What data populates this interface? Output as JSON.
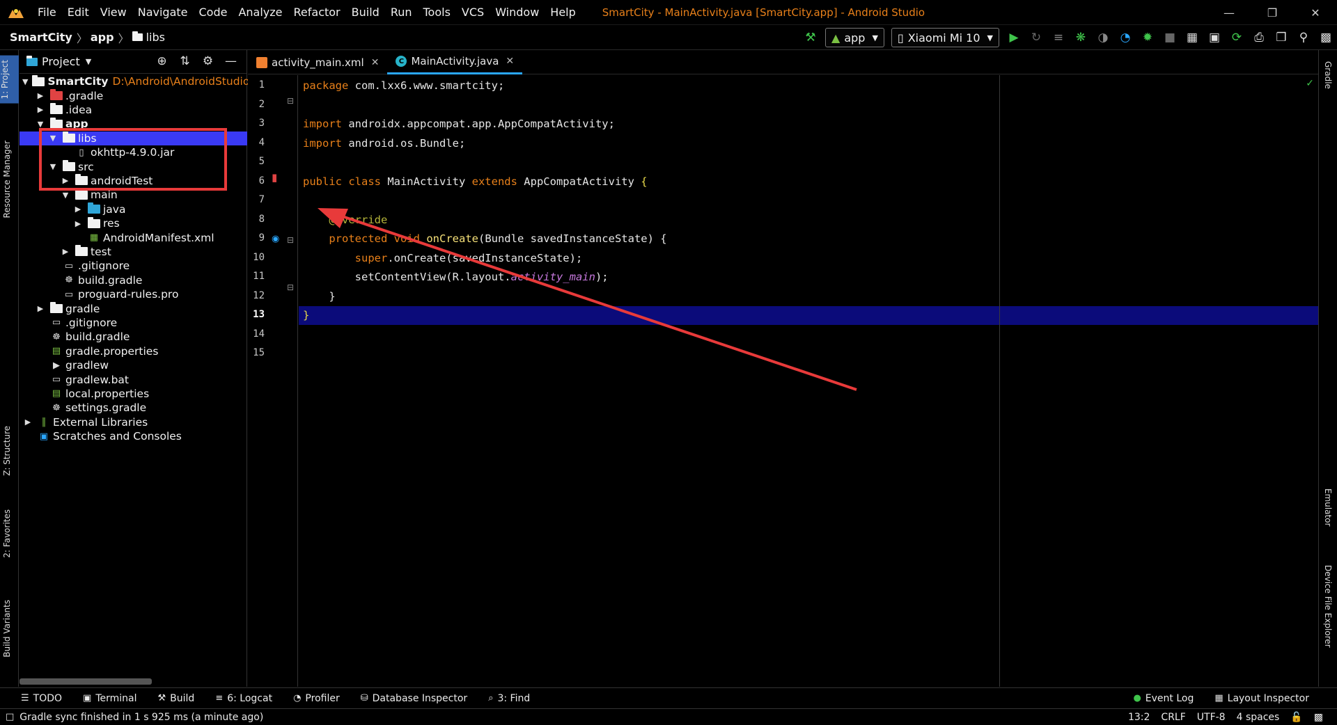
{
  "menu": [
    "File",
    "Edit",
    "View",
    "Navigate",
    "Code",
    "Analyze",
    "Refactor",
    "Build",
    "Run",
    "Tools",
    "VCS",
    "Window",
    "Help"
  ],
  "window_title": "SmartCity - MainActivity.java [SmartCity.app] - Android Studio",
  "breadcrumb": {
    "project": "SmartCity",
    "module": "app",
    "folder": "libs"
  },
  "toolbar": {
    "run_config": "app",
    "device": "Xiaomi Mi 10"
  },
  "left_strip": {
    "project": "1: Project",
    "resource_manager": "Resource Manager",
    "structure": "Z: Structure",
    "favorites": "2: Favorites",
    "build_variants": "Build Variants"
  },
  "right_strip": {
    "gradle": "Gradle",
    "emulator": "Emulator",
    "device_file_explorer": "Device File Explorer"
  },
  "project_panel": {
    "title": "Project",
    "tree": [
      {
        "label": "SmartCity",
        "hint": "D:\\Android\\AndroidStudio",
        "depth": 0,
        "toggle": "▼",
        "icon": "folder",
        "bold": true
      },
      {
        "label": ".gradle",
        "depth": 1,
        "toggle": "▶",
        "icon": "folder-red"
      },
      {
        "label": ".idea",
        "depth": 1,
        "toggle": "▶",
        "icon": "folder"
      },
      {
        "label": "app",
        "depth": 1,
        "toggle": "▼",
        "icon": "folder",
        "bold": true
      },
      {
        "label": "libs",
        "depth": 2,
        "toggle": "▼",
        "icon": "folder",
        "selected": true
      },
      {
        "label": "okhttp-4.9.0.jar",
        "depth": 3,
        "toggle": "",
        "icon": "jar"
      },
      {
        "label": "src",
        "depth": 2,
        "toggle": "▼",
        "icon": "folder"
      },
      {
        "label": "androidTest",
        "depth": 3,
        "toggle": "▶",
        "icon": "folder"
      },
      {
        "label": "main",
        "depth": 3,
        "toggle": "▼",
        "icon": "folder"
      },
      {
        "label": "java",
        "depth": 4,
        "toggle": "▶",
        "icon": "folder-blue"
      },
      {
        "label": "res",
        "depth": 4,
        "toggle": "▶",
        "icon": "folder"
      },
      {
        "label": "AndroidManifest.xml",
        "depth": 4,
        "toggle": "",
        "icon": "manifest"
      },
      {
        "label": "test",
        "depth": 3,
        "toggle": "▶",
        "icon": "folder"
      },
      {
        "label": ".gitignore",
        "depth": 2,
        "toggle": "",
        "icon": "file"
      },
      {
        "label": "build.gradle",
        "depth": 2,
        "toggle": "",
        "icon": "gradle"
      },
      {
        "label": "proguard-rules.pro",
        "depth": 2,
        "toggle": "",
        "icon": "file"
      },
      {
        "label": "gradle",
        "depth": 1,
        "toggle": "▶",
        "icon": "folder"
      },
      {
        "label": ".gitignore",
        "depth": 1,
        "toggle": "",
        "icon": "file"
      },
      {
        "label": "build.gradle",
        "depth": 1,
        "toggle": "",
        "icon": "gradle"
      },
      {
        "label": "gradle.properties",
        "depth": 1,
        "toggle": "",
        "icon": "props"
      },
      {
        "label": "gradlew",
        "depth": 1,
        "toggle": "",
        "icon": "exec"
      },
      {
        "label": "gradlew.bat",
        "depth": 1,
        "toggle": "",
        "icon": "file"
      },
      {
        "label": "local.properties",
        "depth": 1,
        "toggle": "",
        "icon": "props"
      },
      {
        "label": "settings.gradle",
        "depth": 1,
        "toggle": "",
        "icon": "gradle"
      },
      {
        "label": "External Libraries",
        "depth": 0,
        "toggle": "▶",
        "icon": "libs"
      },
      {
        "label": "Scratches and Consoles",
        "depth": 0,
        "toggle": "",
        "icon": "scratch"
      }
    ]
  },
  "tabs": [
    {
      "label": "activity_main.xml",
      "kind": "xml",
      "active": false
    },
    {
      "label": "MainActivity.java",
      "kind": "java",
      "active": true
    }
  ],
  "editor": {
    "current_line": 13,
    "line_numbers": [
      "1",
      "2",
      "3",
      "4",
      "5",
      "6",
      "7",
      "8",
      "9",
      "10",
      "11",
      "12",
      "13",
      "14",
      "15"
    ],
    "lines": [
      "<span class='kw'>package</span> com.lxx6.www.smartcity;",
      "",
      "<span class='kw'>import</span> androidx.appcompat.app.AppCompatActivity;",
      "<span class='kw'>import</span> android.os.Bundle;",
      "",
      "<span class='kw'>public class</span> MainActivity <span class='kw'>extends</span> AppCompatActivity <span class='brace'>{</span>",
      "",
      "    <span class='ann'>@Override</span>",
      "    <span class='kw'>protected void</span> <span class='meth'>onCreate</span>(Bundle savedInstanceState) {",
      "        <span class='kw'>super</span>.onCreate(savedInstanceState);",
      "        setContentView(R.layout.<span class='fld'>activity_main</span>);",
      "    }",
      "<span class='brace'>}</span>",
      "",
      ""
    ]
  },
  "bottom_tools": [
    {
      "icon": "☰",
      "label": "TODO"
    },
    {
      "icon": "▣",
      "label": "Terminal"
    },
    {
      "icon": "⚒",
      "label": "Build"
    },
    {
      "icon": "≡",
      "label": "6: Logcat"
    },
    {
      "icon": "◔",
      "label": "Profiler"
    },
    {
      "icon": "⛁",
      "label": "Database Inspector"
    },
    {
      "icon": "⌕",
      "label": "3: Find"
    }
  ],
  "bottom_right_tools": [
    {
      "icon": "●",
      "label": "Event Log"
    },
    {
      "icon": "▦",
      "label": "Layout Inspector"
    }
  ],
  "status": {
    "message": "Gradle sync finished in 1 s 925 ms (a minute ago)",
    "position": "13:2",
    "line_sep": "CRLF",
    "encoding": "UTF-8",
    "indent": "4 spaces"
  },
  "colors": {
    "accent": "#2aa7ff",
    "selection": "#3a3af5",
    "keyword": "#e8801a",
    "annotation_box": "#e83a3a"
  }
}
